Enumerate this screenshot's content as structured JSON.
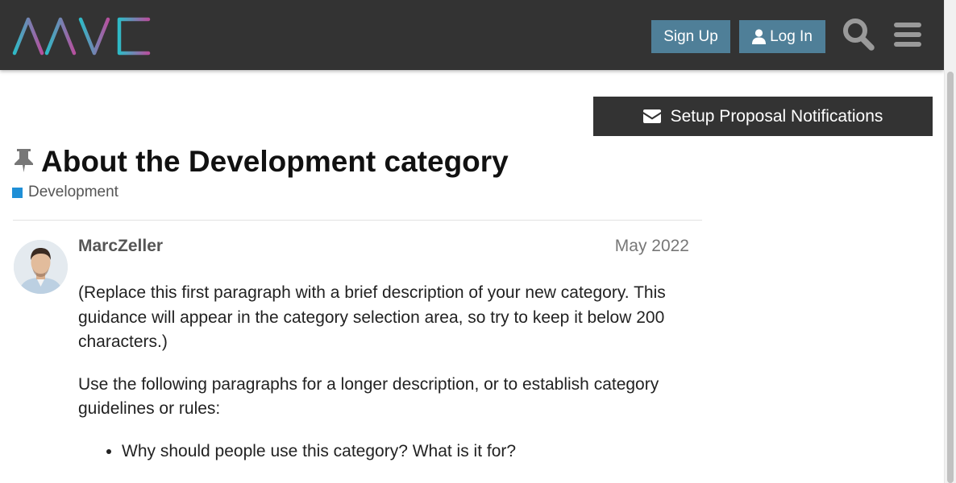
{
  "header": {
    "logo_text": "AAVE",
    "signup_label": "Sign Up",
    "login_label": "Log In",
    "icons": [
      "aave-logo",
      "user-icon",
      "search-icon",
      "hamburger-menu-icon"
    ]
  },
  "notify": {
    "label": "Setup Proposal Notifications",
    "icon": "envelope-icon"
  },
  "topic": {
    "title": "About the Development category",
    "pinned_icon": "pin-icon",
    "category": "Development",
    "category_color": "#1f8fd6"
  },
  "post": {
    "username": "MarcZeller",
    "date": "May 2022",
    "paragraphs": [
      "(Replace this first paragraph with a brief description of your new category. This guidance will appear in the category selection area, so try to keep it below 200 characters.)",
      "Use the following paragraphs for a longer description, or to establish category guidelines or rules:"
    ],
    "bullets": [
      "Why should people use this category? What is it for?"
    ]
  },
  "colors": {
    "header_bg": "#333333",
    "button_bg": "#4f7f98",
    "logo_gradient_start": "#2ebac6",
    "logo_gradient_end": "#b6509e"
  }
}
